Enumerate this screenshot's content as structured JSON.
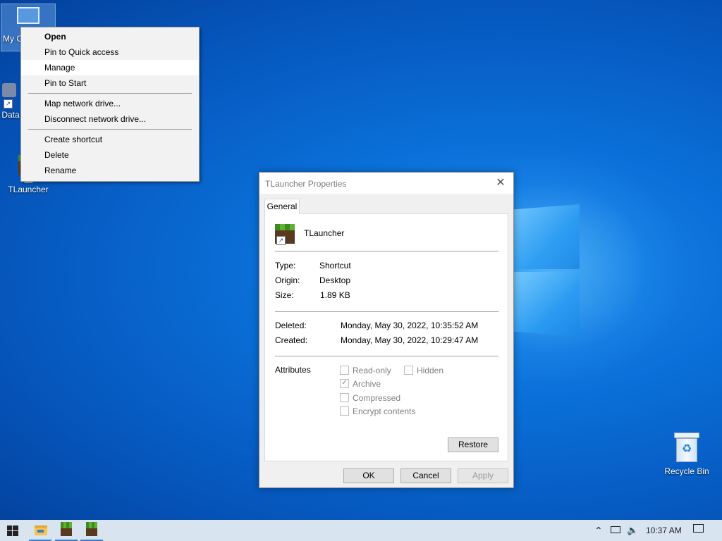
{
  "desktop": {
    "icons": [
      {
        "label": "My Computer"
      },
      {
        "label": "Data"
      },
      {
        "label": "TLauncher"
      },
      {
        "label": "Recycle Bin"
      }
    ]
  },
  "context_menu": {
    "groups": [
      [
        "Open",
        "Pin to Quick access",
        "Manage",
        "Pin to Start"
      ],
      [
        "Map network drive...",
        "Disconnect network drive..."
      ],
      [
        "Create shortcut",
        "Delete",
        "Rename"
      ]
    ],
    "default_item": "Open",
    "highlighted_item": "Manage"
  },
  "dialog": {
    "title": "TLauncher Properties",
    "tab": "General",
    "file_name": "TLauncher",
    "details": [
      {
        "key": "Type:",
        "value": "Shortcut"
      },
      {
        "key": "Origin:",
        "value": "Desktop"
      },
      {
        "key": "Size:",
        "value": "1.89 KB"
      }
    ],
    "dates": [
      {
        "key": "Deleted:",
        "value": "Monday, May 30, 2022, 10:35:52 AM"
      },
      {
        "key": "Created:",
        "value": "Monday, May 30, 2022, 10:29:47 AM"
      }
    ],
    "attributes_label": "Attributes",
    "attributes": {
      "read_only": {
        "label": "Read-only",
        "checked": false
      },
      "hidden": {
        "label": "Hidden",
        "checked": false
      },
      "archive": {
        "label": "Archive",
        "checked": true
      },
      "compressed": {
        "label": "Compressed",
        "checked": false
      },
      "encrypt": {
        "label": "Encrypt contents",
        "checked": false
      }
    },
    "restore_label": "Restore",
    "ok_label": "OK",
    "cancel_label": "Cancel",
    "apply_label": "Apply"
  },
  "taskbar": {
    "clock": "10:37 AM",
    "icons": [
      "windows-start-icon",
      "file-explorer-icon",
      "tlauncher-icon",
      "tlauncher-icon"
    ]
  },
  "colors": {
    "desktop_blue": "#0a6fd8",
    "taskbar": "#d8e4f0",
    "accent": "#3a7bd5"
  }
}
